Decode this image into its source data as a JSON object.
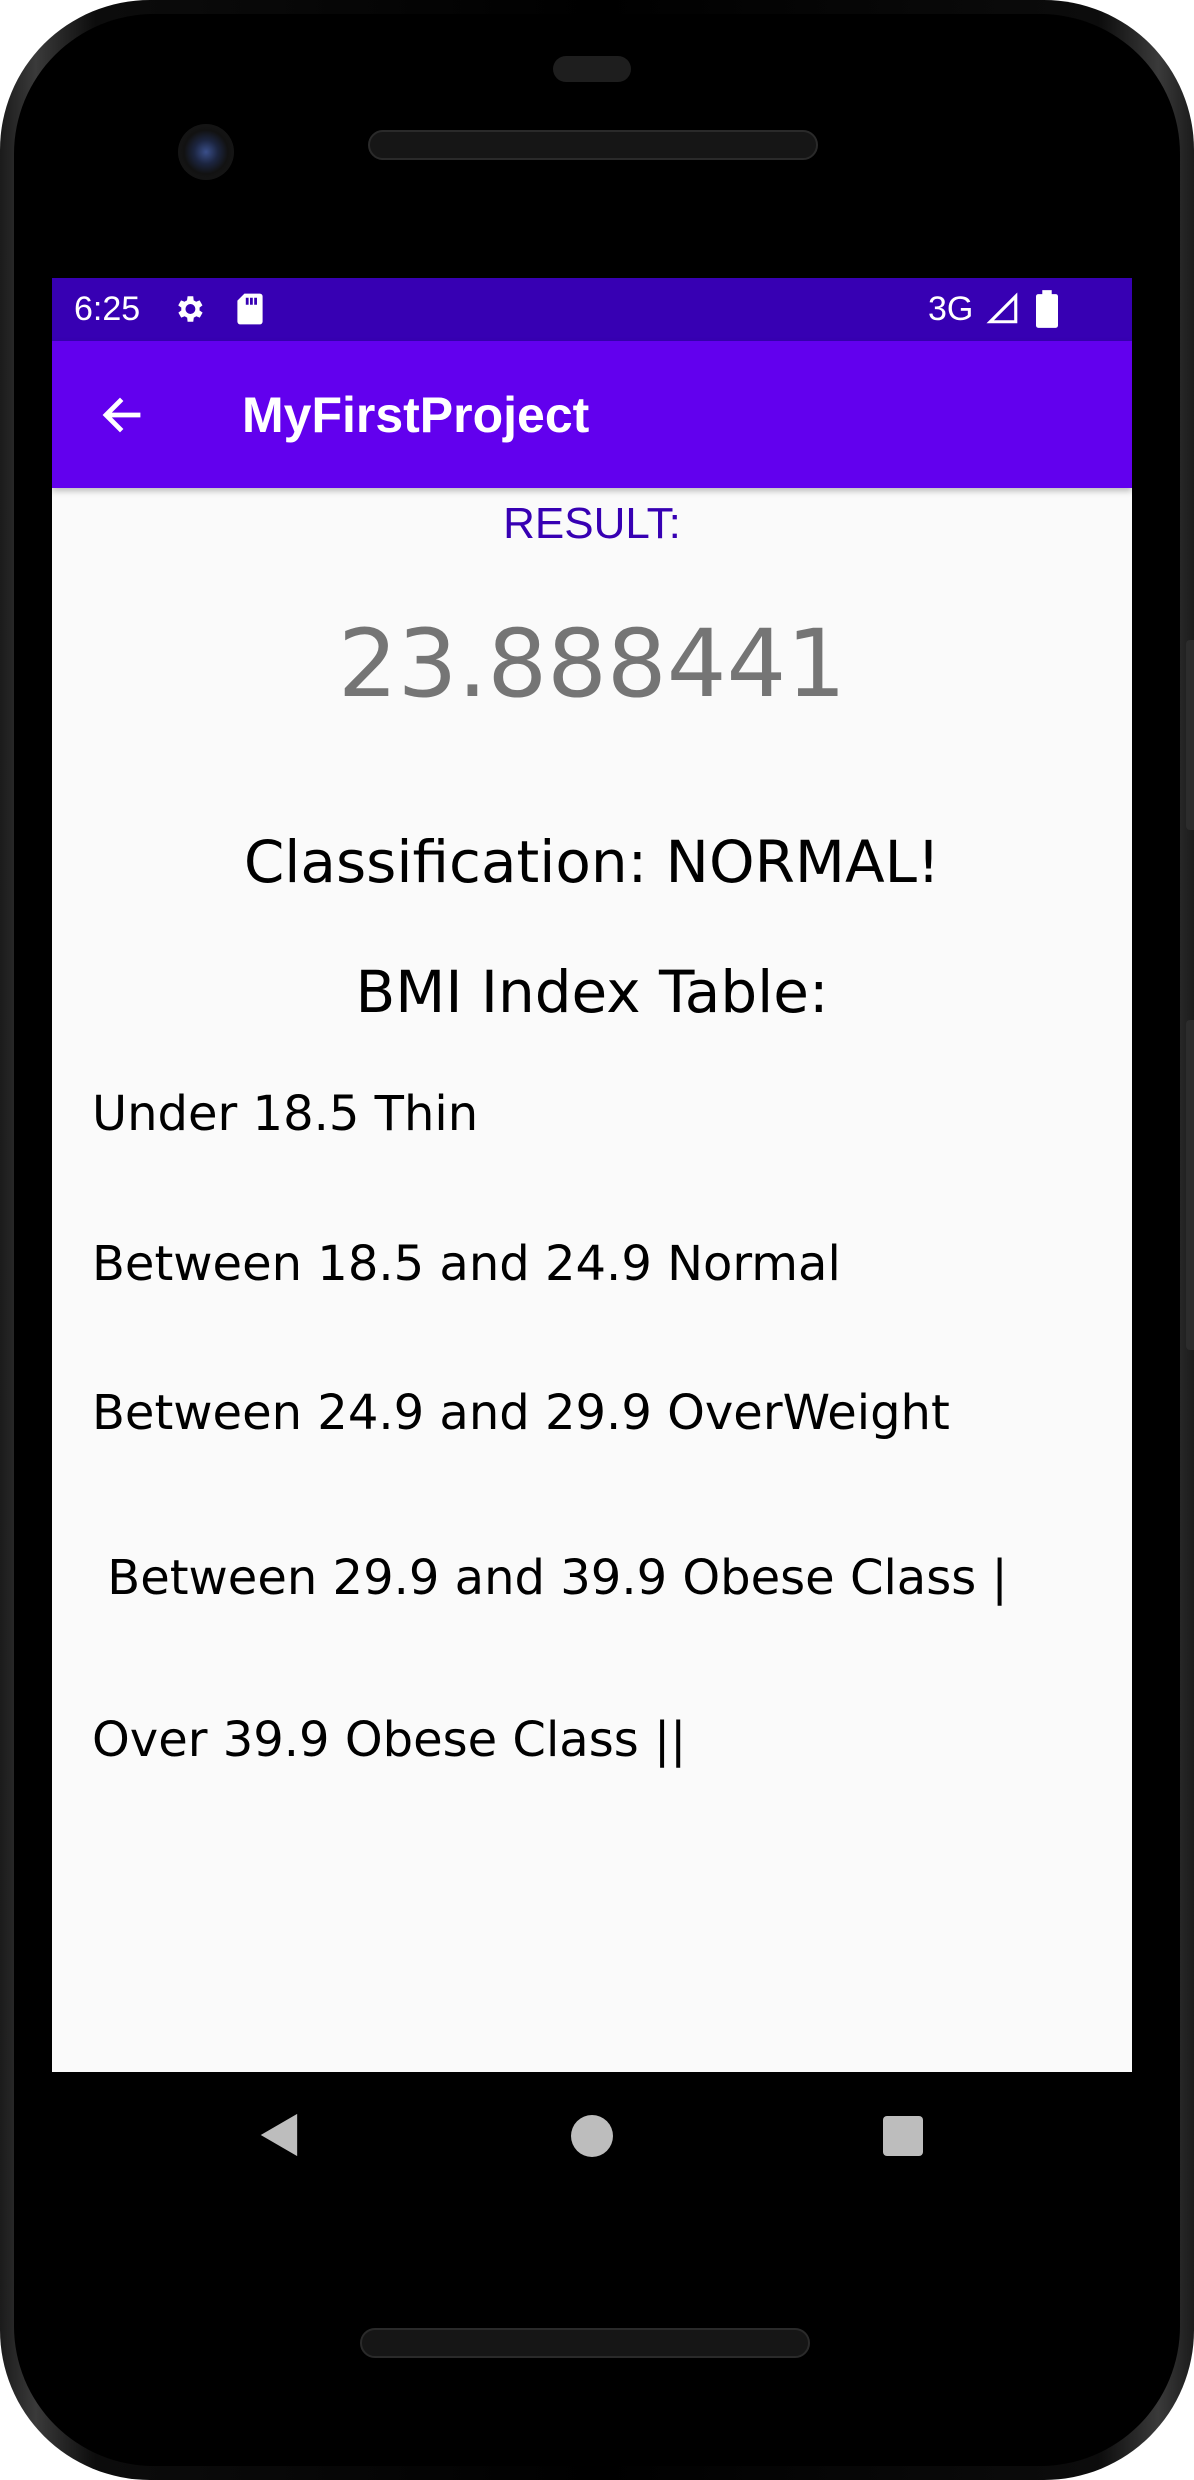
{
  "status_bar": {
    "time": "6:25",
    "network": "3G",
    "icons": [
      "gear-icon",
      "sd-card-icon",
      "signal-icon",
      "battery-icon"
    ]
  },
  "app_bar": {
    "title": "MyFirstProject",
    "back_icon": "arrow-left-icon"
  },
  "main": {
    "result_label": "RESULT:",
    "bmi_value": "23.888441",
    "classification": "Classification: NORMAL!",
    "table_heading": "BMI Index Table:",
    "table_rows": [
      "Under 18.5 Thin",
      "Between 18.5 and 24.9 Normal",
      "Between 24.9 and 29.9 OverWeight",
      " Between 29.9 and 39.9 Obese Class |",
      "Over 39.9 Obese Class ||"
    ]
  },
  "nav_bar": {
    "icons": [
      "nav-back-icon",
      "nav-home-icon",
      "nav-recents-icon"
    ]
  },
  "colors": {
    "status_bar": "#3700b3",
    "app_bar": "#6200ee",
    "result_label": "#3700b3",
    "bmi_value": "#757575",
    "screen_background": "#fafafa"
  }
}
